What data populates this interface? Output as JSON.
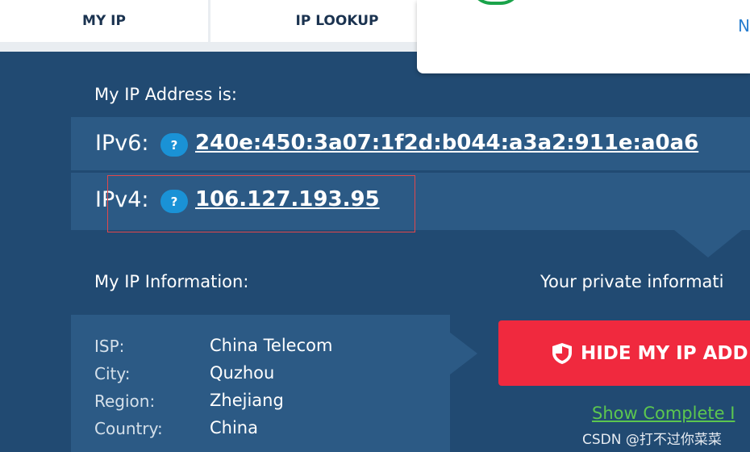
{
  "nav": {
    "tabs": [
      {
        "label": "MY IP"
      },
      {
        "label": "IP LOOKUP"
      }
    ]
  },
  "popup": {
    "link_text": "N"
  },
  "ip_section": {
    "heading": "My IP Address is:",
    "ipv6": {
      "label": "IPv6:",
      "help": "?",
      "value": "240e:450:3a07:1f2d:b044:a3a2:911e:a0a6"
    },
    "ipv4": {
      "label": "IPv4:",
      "help": "?",
      "value": "106.127.193.95"
    }
  },
  "info_section": {
    "heading": "My IP Information:",
    "rows": [
      {
        "key": "ISP:",
        "value": "China Telecom"
      },
      {
        "key": "City:",
        "value": "Quzhou"
      },
      {
        "key": "Region:",
        "value": "Zhejiang"
      },
      {
        "key": "Country:",
        "value": "China"
      }
    ]
  },
  "privacy": {
    "text": "Your private informati",
    "hide_button": "HIDE MY IP ADD",
    "show_link": "Show Complete I"
  },
  "watermark": "CSDN @打不过你菜菜",
  "colors": {
    "background": "#214a72",
    "panel": "#2c5a85",
    "help_badge": "#1a92d6",
    "hide_button": "#f0293e",
    "show_link": "#5cc64f",
    "highlight_box": "#e2474b"
  }
}
